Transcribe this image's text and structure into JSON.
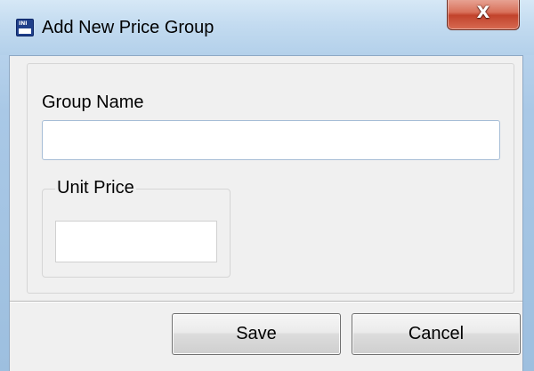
{
  "window": {
    "title": "Add New Price Group",
    "icon": "app-icon",
    "close_label": "X"
  },
  "form": {
    "group_name_label": "Group Name",
    "group_name_value": "",
    "unit_price_label": "Unit Price",
    "unit_price_value": ""
  },
  "buttons": {
    "save_label": "Save",
    "cancel_label": "Cancel"
  },
  "colors": {
    "title_bar": "#c3dbf0",
    "client_background": "#f0f0f0",
    "close_button": "#c2432c"
  }
}
